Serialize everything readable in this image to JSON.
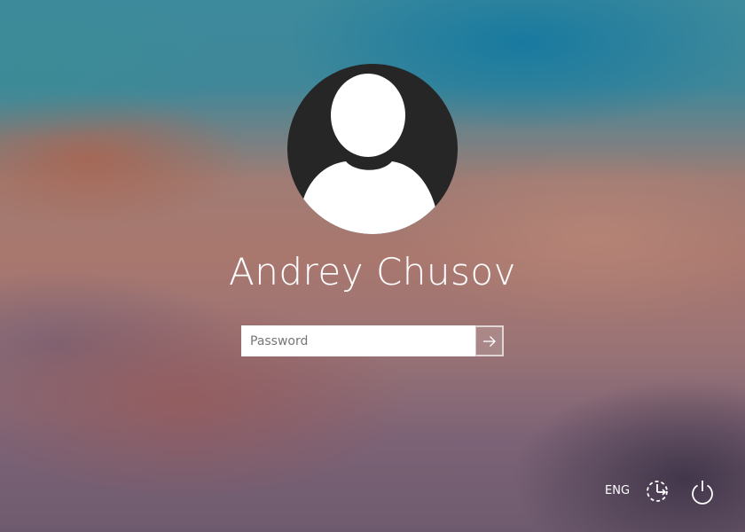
{
  "user": {
    "name": "Andrey Chusov",
    "avatar_icon": "default-user-avatar-icon"
  },
  "password": {
    "placeholder": "Password",
    "value": "",
    "submit_icon": "arrow-right-icon"
  },
  "taskbar": {
    "language": "ENG",
    "ease_of_access_icon": "ease-of-access-icon",
    "power_icon": "power-icon"
  },
  "colors": {
    "avatar_bg": "#262626",
    "text": "#ffffff",
    "input_bg": "#ffffff"
  }
}
